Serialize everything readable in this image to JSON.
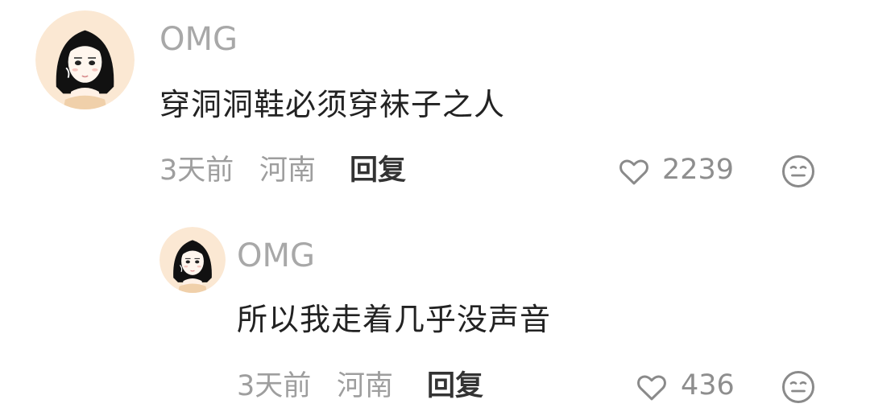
{
  "comments": [
    {
      "avatar_icon": "girl-avatar-icon",
      "username": "OMG",
      "content": "穿洞洞鞋必须穿袜子之人",
      "time": "3天前",
      "location": "河南",
      "reply_label": "回复",
      "like_icon": "heart-outline-icon",
      "like_count": "2239",
      "reaction_icon": "neutral-face-icon"
    },
    {
      "avatar_icon": "girl-avatar-icon",
      "username": "OMG",
      "content": "所以我走着几乎没声音",
      "time": "3天前",
      "location": "河南",
      "reply_label": "回复",
      "like_icon": "heart-outline-icon",
      "like_count": "436",
      "reaction_icon": "neutral-face-icon"
    }
  ],
  "colors": {
    "background": "#ffffff",
    "username": "#a8a8a8",
    "content": "#222222",
    "meta": "#9e9e9e",
    "reply": "#333333",
    "icon": "#8a8a8a",
    "avatar_bg": "#fbe8d3"
  }
}
